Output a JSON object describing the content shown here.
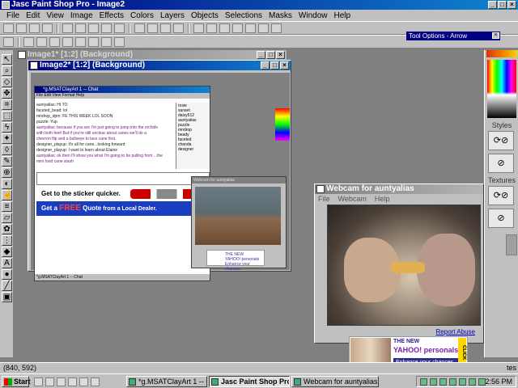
{
  "app": {
    "title": "Jasc Paint Shop Pro - Image2",
    "title_buttons": [
      "_",
      "□",
      "×"
    ]
  },
  "menubar": [
    "File",
    "Edit",
    "View",
    "Image",
    "Effects",
    "Colors",
    "Layers",
    "Objects",
    "Selections",
    "Masks",
    "Window",
    "Help"
  ],
  "tool_options": {
    "title": "Tool Options - Arrow"
  },
  "palette": {
    "styles_label": "Styles",
    "textures_label": "Textures"
  },
  "image1": {
    "title": "Image1* [1:2] (Background)"
  },
  "image2": {
    "title": "Image2* [1:2] (Background)",
    "chat": {
      "title": "*g.MSATClayArt 1 -- Chat",
      "menu": "File  Edit  View  Format  Help",
      "messages": [
        "auntyalias: HI TO",
        "faceted_bead: lol",
        "mndrop_dpm: FE THIS WEEK LOL SOON",
        "puzzle: Yup",
        "auntyalias: because if you are I'm just going to jump into the orchids",
        "with both feet! But if you're still unclear about canes we'll do a",
        "chevron flip and a bullseye to lace cane first.",
        "designer_playup: it's all for cane...looking forward",
        "designer_playup: I want to learn about Elaine",
        "auntyalias: ok then I'll show you what I'm going to be pulling from ...the",
        "mini food cane stash"
      ],
      "users": [
        "rosie",
        "sunset",
        "daisy512",
        "auntyalias",
        "puzzle",
        "mndrop",
        "beady",
        "faceted",
        "chanda",
        "designer"
      ],
      "ad_line1": "Get to the sticker quicker.",
      "ad_line2_pre": "Get a ",
      "ad_line2_free": "FREE",
      "ad_line2_mid": " Quote",
      "ad_line2_post": " from a Local Dealer.",
      "status": "*g.MSATClayArt 1 -- Chat"
    },
    "thumb_webcam": {
      "title": "Webcam for auntyalias",
      "ad_line1": "THE NEW",
      "ad_line2": "YAHOO! personals",
      "ad_line3": "Enhance your chances."
    }
  },
  "webcam_window": {
    "title": "Webcam for auntyalias",
    "menu": [
      "File",
      "Webcam",
      "Help"
    ],
    "report_abuse": "Report Abuse",
    "ad": {
      "line1": "THE NEW",
      "line2": "YAHOO! personals",
      "enhance": "Enhance your chances.",
      "click": "CLICK"
    }
  },
  "statusbar": {
    "coords": "(840, 592)",
    "right": "tes"
  },
  "taskbar": {
    "start": "Start",
    "tasks": [
      {
        "label": "*g.MSATClayArt 1 -- Chat",
        "active": false
      },
      {
        "label": "Jasc Paint Shop Pro - ...",
        "active": true
      },
      {
        "label": "Webcam for auntyalias",
        "active": false
      }
    ],
    "clock": "2:56 PM"
  }
}
